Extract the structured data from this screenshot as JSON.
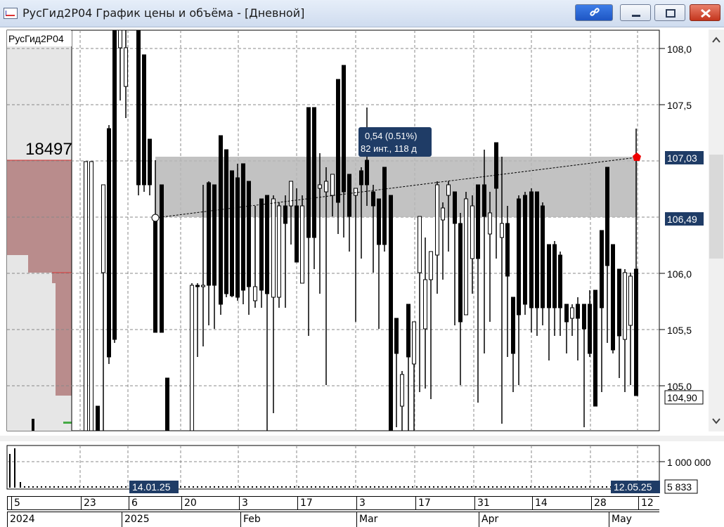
{
  "window": {
    "title": "РусГид2Р04 График цены и объёма - [Дневной]",
    "buttons": [
      "link-icon",
      "minimize-icon",
      "maximize-icon",
      "close-icon"
    ]
  },
  "chart": {
    "instrument_label": "РусГид2Р04",
    "profile_value": "18497",
    "price_axis": [
      "108,0",
      "107,5",
      "106,5",
      "106,0",
      "105,5",
      "105,0"
    ],
    "marker_upper": "107,03",
    "marker_lower": "106,49",
    "last_price": "104,90",
    "tooltip_line1": "0,54 (0.51%)",
    "tooltip_line2": "82 инт., 118 д"
  },
  "volume": {
    "axis_label": "1 000 000",
    "last_value": "5 833",
    "range_start": "14.01.25",
    "range_end": "12.05.25"
  },
  "time_axis": {
    "days": [
      "5",
      "23",
      "6",
      "20",
      "3",
      "17",
      "3",
      "17",
      "31",
      "14",
      "28",
      "12"
    ],
    "months": [
      "2024",
      "2025",
      "Feb",
      "Mar",
      "Apr",
      "May"
    ]
  },
  "colors": {
    "bar": "#000000",
    "band": "#c0c0c0",
    "profile": "#b98c8c",
    "marker": "#1f3c66",
    "window_red": "#c4351d"
  }
}
